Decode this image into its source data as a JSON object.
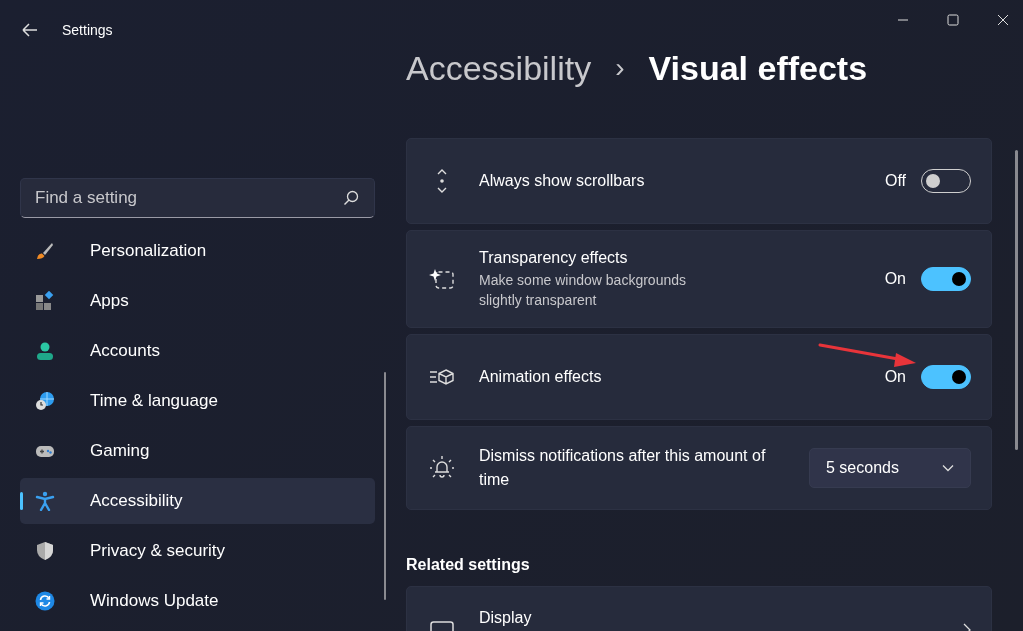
{
  "window": {
    "title": "Settings"
  },
  "search": {
    "placeholder": "Find a setting"
  },
  "nav": [
    {
      "label": "Personalization",
      "selected": false
    },
    {
      "label": "Apps",
      "selected": false
    },
    {
      "label": "Accounts",
      "selected": false
    },
    {
      "label": "Time & language",
      "selected": false
    },
    {
      "label": "Gaming",
      "selected": false
    },
    {
      "label": "Accessibility",
      "selected": true
    },
    {
      "label": "Privacy & security",
      "selected": false
    },
    {
      "label": "Windows Update",
      "selected": false
    }
  ],
  "breadcrumb": {
    "parent": "Accessibility",
    "separator": "›",
    "current": "Visual effects"
  },
  "settings": [
    {
      "kind": "toggle",
      "title": "Always show scrollbars",
      "state_label": "Off",
      "on": false
    },
    {
      "kind": "toggle",
      "title": "Transparency effects",
      "description": "Make some window backgrounds slightly transparent",
      "state_label": "On",
      "on": true
    },
    {
      "kind": "toggle",
      "title": "Animation effects",
      "state_label": "On",
      "on": true
    },
    {
      "kind": "dropdown",
      "title": "Dismiss notifications after this amount of time",
      "value": "5 seconds"
    }
  ],
  "related": {
    "heading": "Related settings",
    "items": [
      {
        "title": "Display"
      }
    ]
  }
}
